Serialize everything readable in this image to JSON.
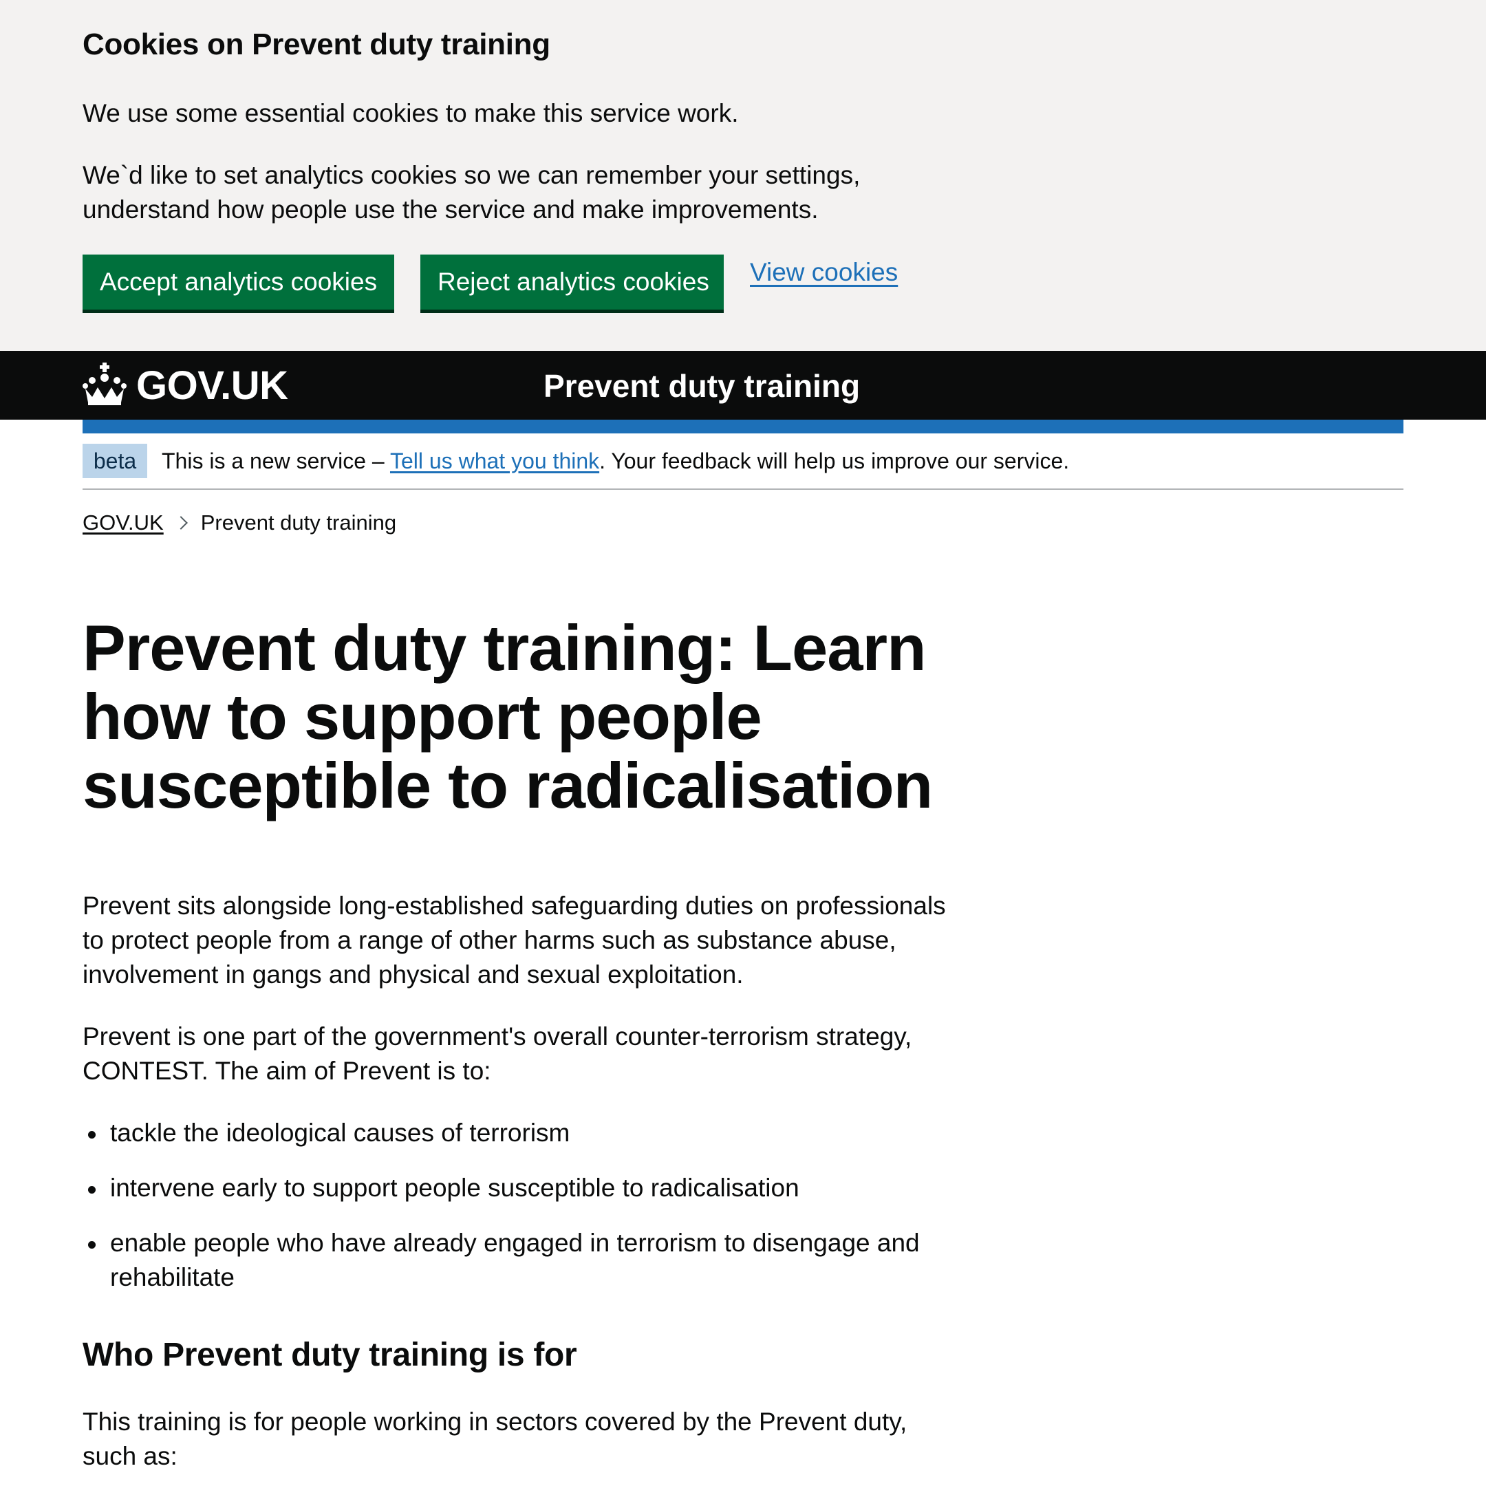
{
  "cookie_banner": {
    "title": "Cookies on Prevent duty training",
    "para1": "We use some essential cookies to make this service work.",
    "para2": "We`d like to set analytics cookies so we can remember your settings, understand how people use the service and make improvements.",
    "accept_label": "Accept analytics cookies",
    "reject_label": "Reject analytics cookies",
    "view_label": "View cookies"
  },
  "header": {
    "logo_text": "GOV.UK",
    "service_name": "Prevent duty training"
  },
  "phase_banner": {
    "tag": "beta",
    "text_before": "This is a new service – ",
    "link": "Tell us what you think",
    "text_after": ". Your feedback will help us improve our service."
  },
  "breadcrumbs": {
    "home": "GOV.UK",
    "current": "Prevent duty training"
  },
  "main": {
    "title": "Prevent duty training: Learn how to support people susceptible to radicalisation",
    "para1": "Prevent sits alongside long-established safeguarding duties on professionals to protect people from a range of other harms such as substance abuse, involvement in gangs and physical and sexual exploitation.",
    "para2": "Prevent is one part of the government's overall counter-terrorism strategy, CONTEST. The aim of Prevent is to:",
    "bullets": [
      "tackle the ideological causes of terrorism",
      "intervene early to support people susceptible to radicalisation",
      "enable people who have already engaged in terrorism to disengage and rehabilitate"
    ],
    "subheading": "Who Prevent duty training is for",
    "para3": "This training is for people working in sectors covered by the Prevent duty, such as:"
  },
  "colors": {
    "button_green": "#00703c",
    "link_blue": "#1d70b8",
    "header_black": "#0b0c0c",
    "banner_grey": "#f3f2f1",
    "beta_tag_bg": "#bbd4ea"
  }
}
